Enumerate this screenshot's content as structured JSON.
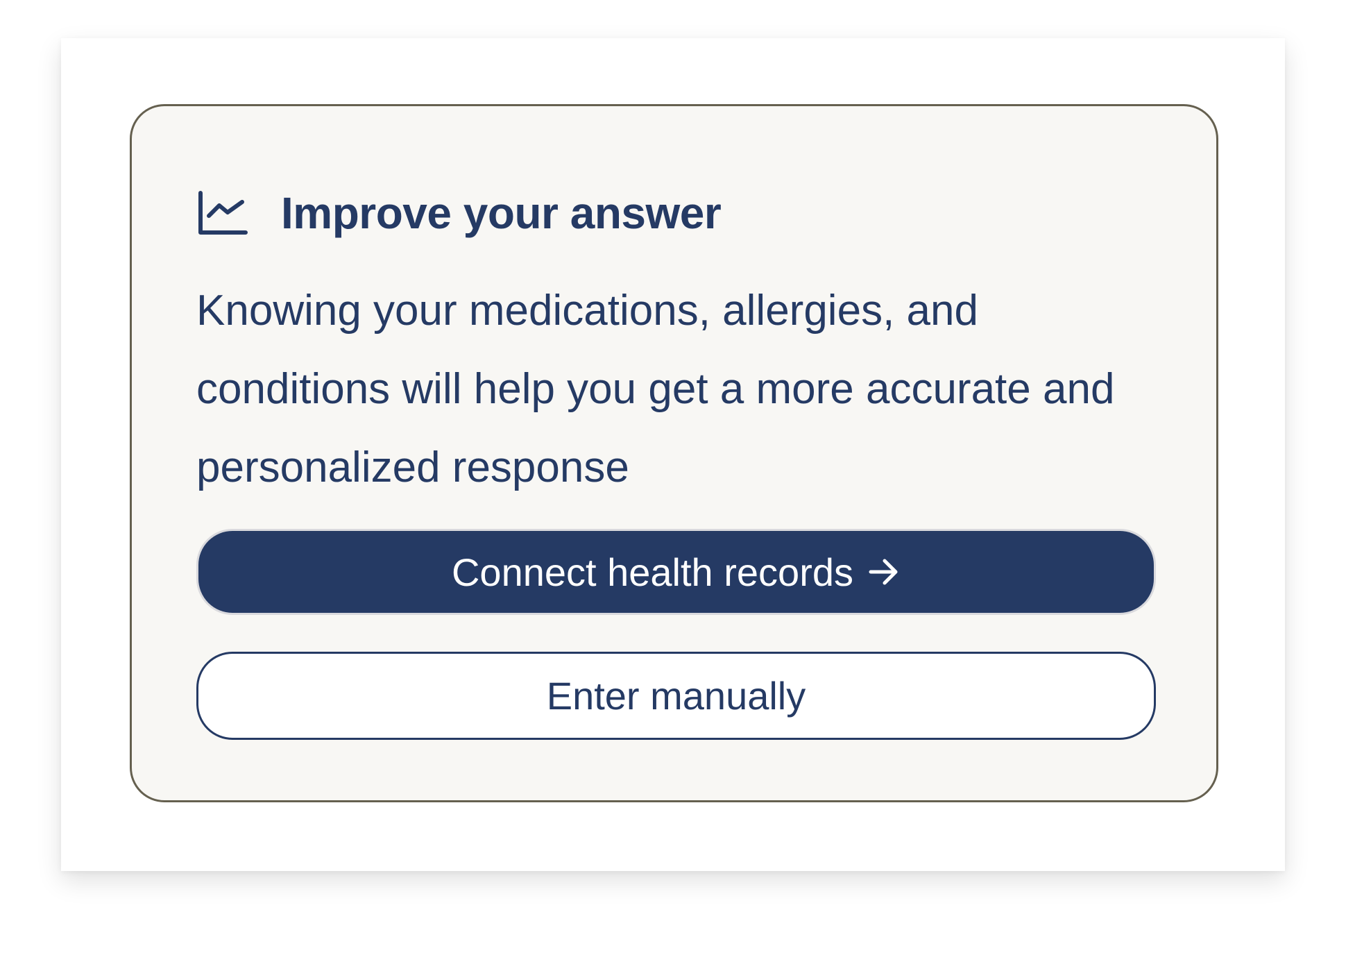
{
  "card": {
    "icon": "line-chart-icon",
    "title": "Improve your answer",
    "description": "Knowing your medications, allergies, and conditions will help you get a more accurate and personalized response"
  },
  "buttons": {
    "connect_label": "Connect health records",
    "connect_icon": "arrow-right-icon",
    "manual_label": "Enter manually"
  },
  "colors": {
    "primary": "#253a64",
    "card_background": "#f8f7f4",
    "card_border": "#65604f",
    "text": "#253a64"
  }
}
